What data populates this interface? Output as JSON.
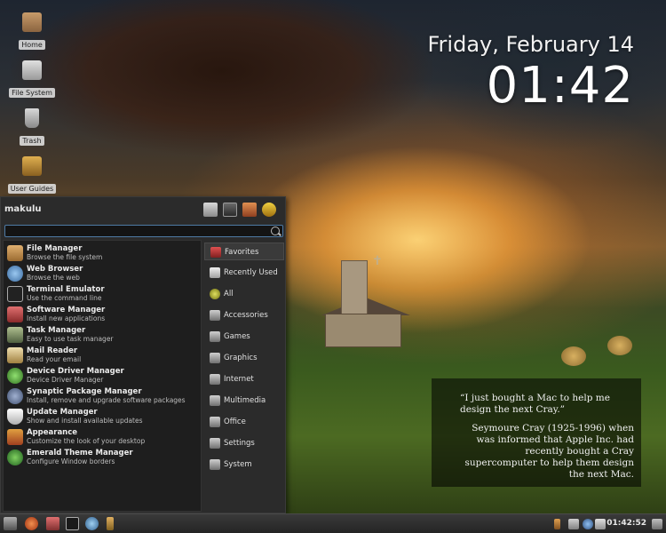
{
  "desktop": {
    "icons": [
      {
        "label": "Home",
        "icon": "home-folder-icon"
      },
      {
        "label": "File System",
        "icon": "drive-icon"
      },
      {
        "label": "Trash",
        "icon": "trash-icon"
      },
      {
        "label": "User Guides",
        "icon": "user-guides-icon"
      }
    ]
  },
  "clock_widget": {
    "date": "Friday, February 14",
    "time": "01:42"
  },
  "quote": {
    "text": "“I just bought a Mac to help me design the next Cray.”",
    "attribution": "Seymoure Cray (1925-1996) when was informed that Apple Inc. had recently bought a Cray supercomputer to help them design the next Mac."
  },
  "menu": {
    "user": "makulu",
    "header_buttons": [
      "settings-icon",
      "terminal-icon",
      "tools-icon",
      "logout-icon"
    ],
    "search": {
      "value": "",
      "placeholder": ""
    },
    "apps": [
      {
        "name": "File Manager",
        "desc": "Browse the file system",
        "icon": "file-manager-icon"
      },
      {
        "name": "Web Browser",
        "desc": "Browse the web",
        "icon": "web-browser-icon"
      },
      {
        "name": "Terminal Emulator",
        "desc": "Use the command line",
        "icon": "terminal-icon"
      },
      {
        "name": "Software Manager",
        "desc": "Install new applications",
        "icon": "software-manager-icon"
      },
      {
        "name": "Task Manager",
        "desc": "Easy to use task manager",
        "icon": "task-manager-icon"
      },
      {
        "name": "Mail Reader",
        "desc": "Read your email",
        "icon": "mail-icon"
      },
      {
        "name": "Device Driver Manager",
        "desc": "Device Driver Manager",
        "icon": "device-driver-icon"
      },
      {
        "name": "Synaptic Package Manager",
        "desc": "Install, remove and upgrade software packages",
        "icon": "synaptic-icon"
      },
      {
        "name": "Update Manager",
        "desc": "Show and install available updates",
        "icon": "update-shield-icon"
      },
      {
        "name": "Appearance",
        "desc": "Customize the look of your desktop",
        "icon": "appearance-icon"
      },
      {
        "name": "Emerald Theme Manager",
        "desc": "Configure Window borders",
        "icon": "emerald-icon"
      }
    ],
    "categories": [
      {
        "label": "Favorites",
        "icon": "favorites-icon",
        "active": true
      },
      {
        "label": "Recently Used",
        "icon": "recent-icon"
      },
      {
        "label": "All",
        "icon": "all-icon"
      },
      {
        "label": "Accessories",
        "icon": "accessories-icon"
      },
      {
        "label": "Games",
        "icon": "games-icon"
      },
      {
        "label": "Graphics",
        "icon": "graphics-icon"
      },
      {
        "label": "Internet",
        "icon": "internet-icon"
      },
      {
        "label": "Multimedia",
        "icon": "multimedia-icon"
      },
      {
        "label": "Office",
        "icon": "office-icon"
      },
      {
        "label": "Settings",
        "icon": "settings-icon"
      },
      {
        "label": "System",
        "icon": "system-icon"
      }
    ]
  },
  "taskbar": {
    "launchers": [
      "menu-icon",
      "browser-icon",
      "file-manager-icon",
      "terminal-icon",
      "network-browser-icon",
      "bottle-icon"
    ],
    "tray": [
      "battery-icon",
      "network-icon",
      "globe-icon",
      "display-icon"
    ],
    "clock": "01:42:52"
  },
  "colors": {
    "menu_bg": "#2b2b2b",
    "accent": "#4e7aa4"
  }
}
